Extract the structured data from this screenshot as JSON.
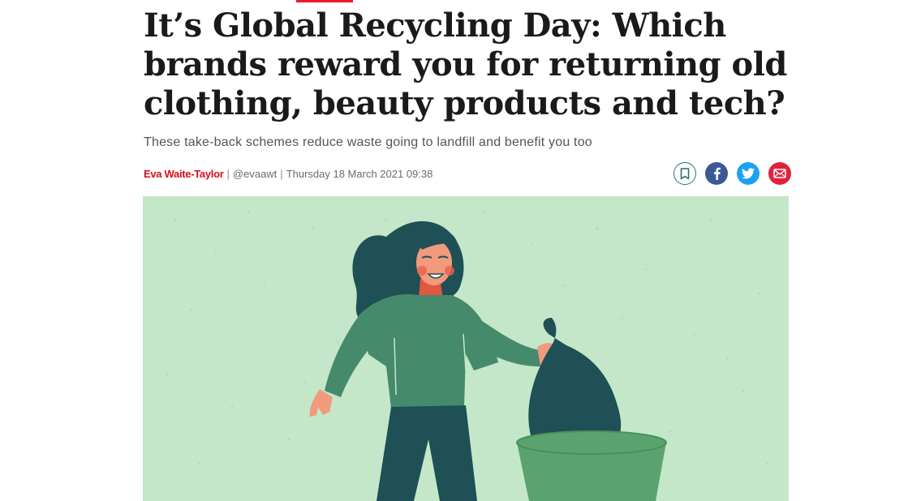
{
  "article": {
    "headline": "It’s Global Recycling Day: Which brands reward you for returning old clothing, beauty products and tech?",
    "standfirst": "These take-back schemes reduce waste going to landfill and benefit you too",
    "byline": {
      "author": "Eva Waite-Taylor",
      "separator": "|",
      "handle": "@evaawt",
      "date": "Thursday 18 March 2021 09:38"
    }
  },
  "share": {
    "icons": [
      "bookmark-icon",
      "facebook-icon",
      "twitter-icon",
      "email-icon"
    ]
  },
  "colors": {
    "brand_red": "#ec1a2e",
    "author_red": "#d70d1a",
    "hero_background": "#c4e7c9",
    "illustration_teal": "#1e5055",
    "illustration_green": "#468a6c",
    "bin_green": "#5aa36f"
  }
}
